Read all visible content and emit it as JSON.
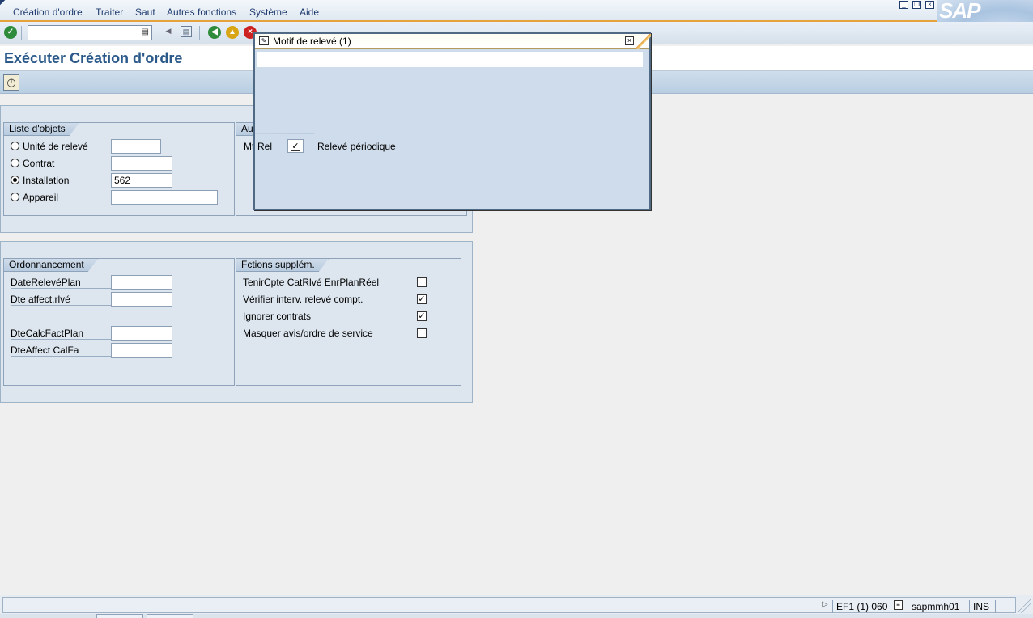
{
  "menubar": {
    "items": [
      {
        "label": "Création d'ordre",
        "key": "C"
      },
      {
        "label": "Traiter",
        "key": "T"
      },
      {
        "label": "Saut",
        "key": "S"
      },
      {
        "label": "Autres fonctions",
        "key": "A"
      },
      {
        "label": "Système",
        "key": "y"
      },
      {
        "label": "Aide",
        "key": "A"
      }
    ],
    "logo_text": "SAP"
  },
  "toolbar": {
    "command_value": "",
    "icons": [
      "enter-icon",
      "command-dropdown-icon",
      "back-arrow-icon",
      "save-icon",
      "back-icon",
      "exit-icon",
      "cancel-icon",
      "print-icon",
      "find-icon",
      "find-next-icon",
      "first-page-icon",
      "prev-page-icon",
      "next-page-icon",
      "last-page-icon",
      "new-session-icon",
      "shortcut-icon",
      "help-icon",
      "layout-icon"
    ]
  },
  "page": {
    "title": "Exécuter Création d'ordre"
  },
  "app_toolbar": {
    "execute_icon": "execute-clock-icon"
  },
  "objects_group": {
    "title": "Liste d'objets",
    "rows": [
      {
        "label": "Unité de relevé",
        "value": "",
        "selected": false
      },
      {
        "label": "Contrat",
        "value": "",
        "selected": false
      },
      {
        "label": "Installation",
        "value": "562",
        "selected": true
      },
      {
        "label": "Appareil",
        "value": "",
        "selected": false
      }
    ]
  },
  "other_group": {
    "title_visible": "Au",
    "mtrel_label_visible": "Mt",
    "mtrel_label": "MtRel"
  },
  "scheduling_group": {
    "title": "Ordonnancement",
    "rows": [
      {
        "label": "DateRelevéPlan",
        "value": ""
      },
      {
        "label": "Dte affect.rlvé",
        "value": ""
      },
      {
        "label": "DteCalcFactPlan",
        "value": ""
      },
      {
        "label": "DteAffect CalFa",
        "value": ""
      }
    ]
  },
  "extra_group": {
    "title": "Fctions supplém.",
    "rows": [
      {
        "label": "TenirCpte CatRlvé EnrPlanRéel",
        "checked": false
      },
      {
        "label": "Vérifier interv. relevé compt.",
        "checked": true
      },
      {
        "label": "Ignorer contrats",
        "checked": true
      },
      {
        "label": "Masquer avis/ordre de service",
        "checked": false
      }
    ]
  },
  "dialog": {
    "title": "Motif de relevé (1)",
    "field_label_visible": "Rel",
    "field_checked": true,
    "field_text": "Relevé périodique"
  },
  "statusbar": {
    "system": "EF1 (1) 060",
    "server": "sapmmh01",
    "mode": "INS"
  }
}
